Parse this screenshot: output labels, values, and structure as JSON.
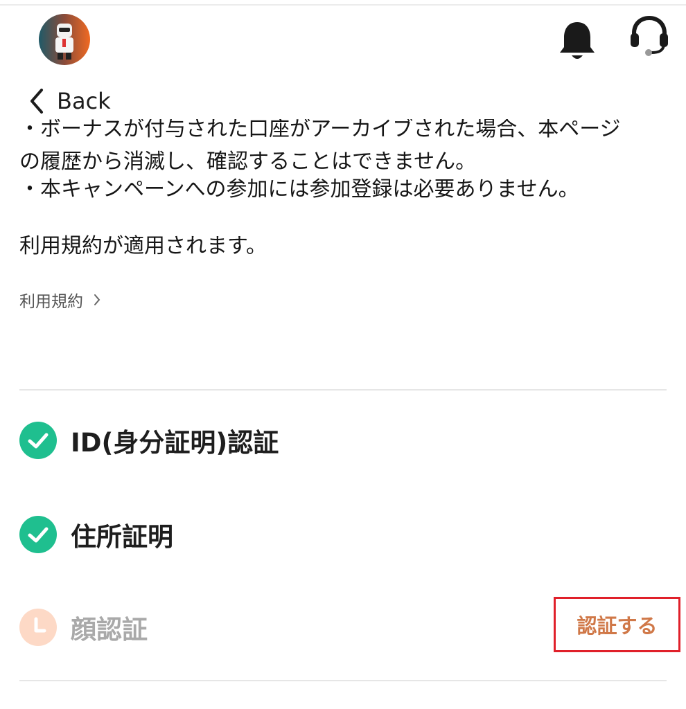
{
  "header": {
    "avatar_icon": "avatar",
    "notification_icon": "bell-icon",
    "support_icon": "headset-icon",
    "back_label": "Back"
  },
  "notes": {
    "clipped_line": "・ボーナスが付与された口座がアーカイブされた場合、本ページ",
    "line_2": "の履歴から消滅し、確認することはできません。",
    "line_3": "・本キャンペーンへの参加には参加登録は必要ありません。",
    "terms_notice": "利用規約が適用されます。",
    "terms_link": "利用規約"
  },
  "verification": {
    "items": [
      {
        "label": "ID(身分証明)認証",
        "status": "complete"
      },
      {
        "label": "住所証明",
        "status": "complete"
      },
      {
        "label": "顔認証",
        "status": "pending",
        "action_label": "認証する"
      }
    ]
  },
  "colors": {
    "complete": "#1fbf8f",
    "pending": "#fdd9c6",
    "action_text": "#d07848",
    "highlight_border": "#e0202a"
  }
}
